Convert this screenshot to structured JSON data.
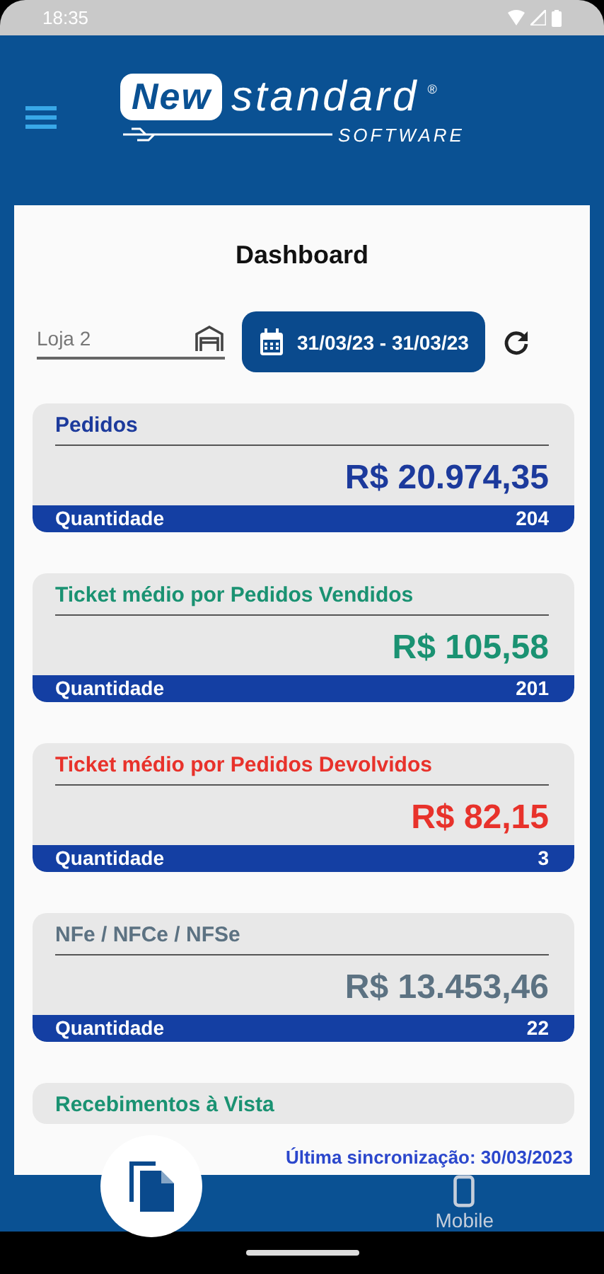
{
  "status_bar": {
    "time": "18:35"
  },
  "header": {
    "logo": {
      "badge": "New",
      "word": "standard",
      "mark": "®",
      "sub": "SOFTWARE"
    }
  },
  "title": "Dashboard",
  "filters": {
    "store": {
      "value": "Loja 2"
    },
    "date_range": "31/03/23 - 31/03/23"
  },
  "cards": [
    {
      "title": "Pedidos",
      "value": "R$ 20.974,35",
      "footer_label": "Quantidade",
      "count": "204",
      "color": "#1c3a9c"
    },
    {
      "title": "Ticket médio por Pedidos Vendidos",
      "value": "R$ 105,58",
      "footer_label": "Quantidade",
      "count": "201",
      "color": "#1a9272"
    },
    {
      "title": "Ticket médio por Pedidos Devolvidos",
      "value": "R$ 82,15",
      "footer_label": "Quantidade",
      "count": "3",
      "color": "#e8322b"
    },
    {
      "title": "NFe / NFCe / NFSe",
      "value": "R$ 13.453,46",
      "footer_label": "Quantidade",
      "count": "22",
      "color": "#5c7282"
    },
    {
      "title": "Recebimentos à Vista",
      "color": "#1a9272"
    }
  ],
  "sync": "Última sincronização: 30/03/2023",
  "bottom_nav": {
    "items": [
      {
        "label": "Mobile"
      }
    ]
  }
}
